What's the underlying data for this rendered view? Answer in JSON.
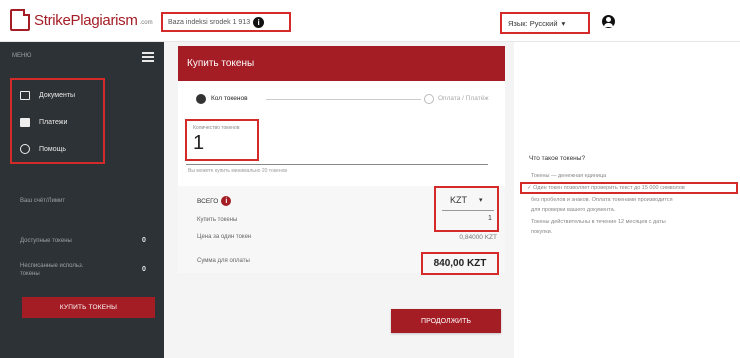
{
  "header": {
    "logo_text": "StrikePlagiarism",
    "logo_suffix": ".com",
    "search_info": "Baza indeksi srodek 1 913",
    "lang_label": "Язык: Русский",
    "lang_caret": "▾",
    "info_glyph": "i"
  },
  "sidebar": {
    "menu_label": "МЕНЮ",
    "items": [
      {
        "label": "Документы",
        "icon": "folder-icon"
      },
      {
        "label": "Платежи",
        "icon": "card-icon"
      },
      {
        "label": "Помощь",
        "icon": "clock-icon"
      }
    ],
    "account_label": "Ваш счёт/Лимит",
    "stats": [
      {
        "label": "Доступные токены",
        "value": "0"
      },
      {
        "label": "Несписанные использ. токены",
        "value": "0"
      }
    ],
    "buy_button": "КУПИТЬ ТОКЕНЫ"
  },
  "panel": {
    "title": "Купить токены",
    "step1": "Кол токенов",
    "step2": "Оплата / Платёж",
    "qty_label": "Количество токенов",
    "qty_value": "1",
    "qty_hint": "Вы можете купить минимально 20 токенов",
    "total_label": "ВСЕГО",
    "total_glyph": "i",
    "tokens_label": "Купить токены",
    "price_label": "Цена за один токен",
    "invoice_label": "Сумма для оплаты",
    "currency": "KZT",
    "currency_caret": "▾",
    "unit_value": "1",
    "price_value": "0,84000 KZT",
    "amount": "840,00 KZT",
    "continue_button": "ПРОДОЛЖИТЬ"
  },
  "faq": {
    "title": "Что такое токены?",
    "lines": [
      "Токены — денежная единица",
      "✓ Один токен позволяет проверить текст до 15 000 символов",
      "без пробелов и знаков. Оплата токенами производится",
      "для проверки вашего документа.",
      "Токены действительны в течение 12 месяцев с даты",
      "покупки."
    ]
  },
  "colors": {
    "brand": "#a41d25",
    "sidebar": "#2d3236",
    "highlight": "#d42a2a"
  }
}
